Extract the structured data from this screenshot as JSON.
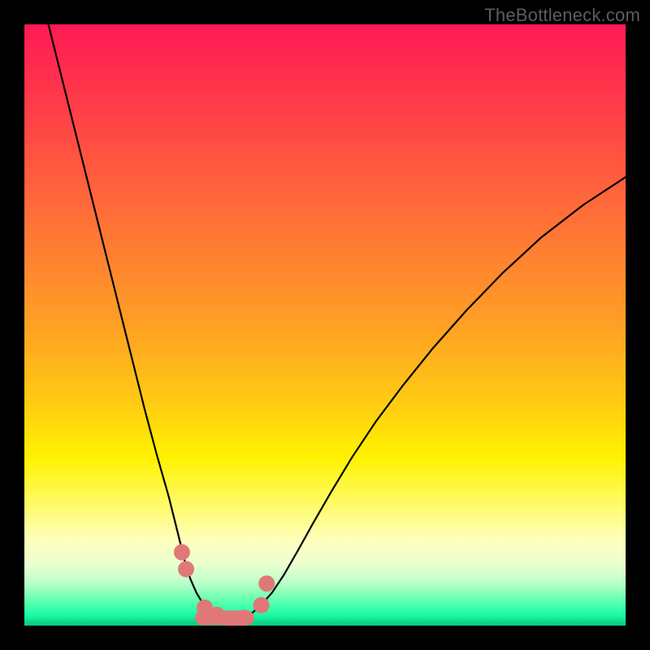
{
  "watermark": "TheBottleneck.com",
  "chart_data": {
    "type": "line",
    "title": "",
    "xlabel": "",
    "ylabel": "",
    "xlim": [
      0,
      1
    ],
    "ylim": [
      0,
      1
    ],
    "grid": false,
    "series": [
      {
        "name": "bottleneck-curve",
        "color": "#000000",
        "width": 2.2,
        "x": [
          0.04,
          0.06,
          0.08,
          0.1,
          0.12,
          0.14,
          0.16,
          0.18,
          0.2,
          0.22,
          0.24,
          0.255,
          0.266,
          0.276,
          0.286,
          0.295,
          0.305,
          0.32,
          0.335,
          0.348,
          0.36,
          0.375,
          0.392,
          0.412,
          0.432,
          0.455,
          0.48,
          0.51,
          0.545,
          0.585,
          0.63,
          0.68,
          0.735,
          0.795,
          0.86,
          0.93,
          1.0
        ],
        "y": [
          1.0,
          0.92,
          0.84,
          0.76,
          0.68,
          0.6,
          0.52,
          0.44,
          0.36,
          0.285,
          0.215,
          0.155,
          0.11,
          0.078,
          0.055,
          0.04,
          0.03,
          0.018,
          0.01,
          0.009,
          0.01,
          0.018,
          0.032,
          0.055,
          0.085,
          0.125,
          0.17,
          0.222,
          0.28,
          0.34,
          0.4,
          0.462,
          0.524,
          0.586,
          0.646,
          0.7,
          0.746
        ]
      },
      {
        "name": "highlight-markers",
        "color": "#e07878",
        "marker_radius": 10,
        "x": [
          0.262,
          0.269,
          0.3,
          0.32,
          0.345,
          0.365,
          0.394,
          0.403
        ],
        "y": [
          0.122,
          0.094,
          0.03,
          0.018,
          0.01,
          0.013,
          0.034,
          0.07
        ]
      },
      {
        "name": "highlight-segment",
        "color": "#e07878",
        "width": 18,
        "x": [
          0.296,
          0.37
        ],
        "y": [
          0.013,
          0.013
        ]
      }
    ]
  }
}
